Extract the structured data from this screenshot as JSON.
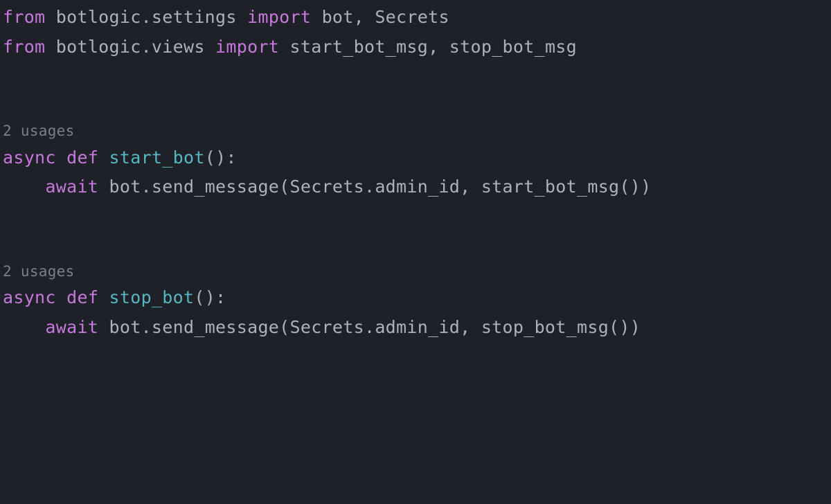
{
  "colors": {
    "background": "#1e2127",
    "keyword": "#c678dd",
    "function": "#56b6c2",
    "identifier": "#abb2bf",
    "hint": "#7a7f8a"
  },
  "lines": {
    "l1": {
      "from": "from",
      "mod": "botlogic.settings",
      "import": "import",
      "names": "bot, Secrets"
    },
    "l2": {
      "from": "from",
      "mod": "botlogic.views",
      "import": "import",
      "names": "start_bot_msg, stop_bot_msg"
    },
    "hint1": "2 usages",
    "l3": {
      "async": "async",
      "def": "def",
      "name": "start_bot",
      "sig": "():"
    },
    "l4": {
      "indent": "    ",
      "await": "await",
      "body": "bot.send_message(Secrets.admin_id, start_bot_msg())"
    },
    "hint2": "2 usages",
    "l5": {
      "async": "async",
      "def": "def",
      "name": "stop_bot",
      "sig": "():"
    },
    "l6": {
      "indent": "    ",
      "await": "await",
      "body": "bot.send_message(Secrets.admin_id, stop_bot_msg())"
    }
  }
}
